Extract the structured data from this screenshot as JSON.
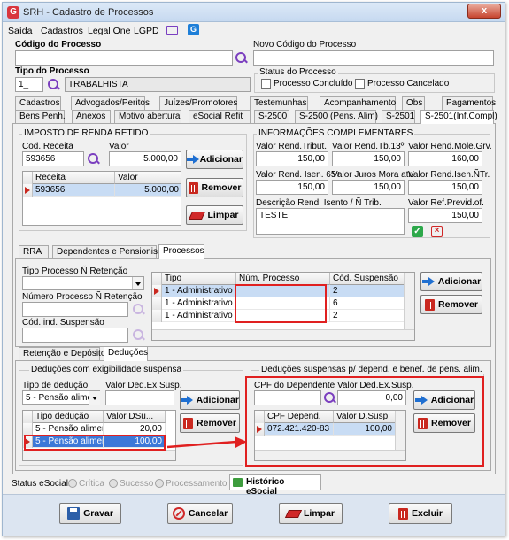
{
  "window": {
    "title": "SRH - Cadastro de Processos",
    "close_label": "x",
    "logo": "G"
  },
  "menu": {
    "items": [
      "Saída",
      "Cadastros",
      "Legal One",
      "LGPD"
    ],
    "g_icon": "G"
  },
  "header": {
    "codigo_label": "Código do Processo",
    "codigo_value": "",
    "novo_codigo_label": "Novo Código do Processo",
    "novo_codigo_value": "",
    "tipo_label": "Tipo do Processo",
    "tipo_code": "1_",
    "tipo_name": "TRABALHISTA",
    "status_label": "Status do Processo",
    "status_concluido": "Processo Concluído",
    "status_cancelado": "Processo Cancelado"
  },
  "tabs_row1": [
    "Cadastros",
    "Advogados/Peritos",
    "Juízes/Promotores",
    "Testemunhas",
    "Acompanhamento",
    "Obs",
    "Pagamentos"
  ],
  "tabs_row2": [
    "Bens Penh.",
    "Anexos",
    "Motivo abertura",
    "eSocial Refit",
    "S-2500",
    "S-2500 (Pens. Alim)",
    "S-2501",
    "S-2501(Inf.Compl)"
  ],
  "irrf": {
    "title": "IMPOSTO DE RENDA RETIDO",
    "cod_receita_label": "Cod. Receita",
    "cod_receita_value": "593656",
    "valor_label": "Valor",
    "valor_value": "5.000,00",
    "adicionar": "Adicionar",
    "remover": "Remover",
    "limpar": "Limpar",
    "grid_headers": [
      "Receita",
      "Valor"
    ],
    "grid_rows": [
      [
        "593656",
        "5.000,00"
      ]
    ]
  },
  "info": {
    "title": "INFORMAÇÕES COMPLEMENTARES",
    "f1_label": "Valor Rend.Tribut.",
    "f1_value": "150,00",
    "f2_label": "Valor Rend.Tb.13º",
    "f2_value": "150,00",
    "f3_label": "Valor Rend.Mole.Grv.",
    "f3_value": "160,00",
    "f4_label": "Valor Rend. Isen. 65+",
    "f4_value": "150,00",
    "f5_label": "Valor Juros Mora atr.",
    "f5_value": "150,00",
    "f6_label": "Valor Rend.Isen.ÑTr.",
    "f6_value": "150,00",
    "desc_label": "Descrição Rend. Isento / Ñ Trib.",
    "desc_value": "TESTE",
    "prev_label": "Valor Ref.Previd.of.",
    "prev_value": "150,00"
  },
  "subtabs": [
    "RRA",
    "Dependentes e Pensionistas",
    "Processos"
  ],
  "processos": {
    "tipo_label": "Tipo Processo Ñ Retenção",
    "numero_label": "Número Processo Ñ Retenção",
    "cod_ind_label": "Cód. ind. Suspensão",
    "grid_headers": [
      "Tipo",
      "Núm. Processo",
      "Cód. Suspensão"
    ],
    "grid_rows": [
      [
        "1 - Administrativo",
        "",
        "2"
      ],
      [
        "1 - Administrativo",
        "",
        "6"
      ],
      [
        "1 - Administrativo",
        "",
        "2"
      ]
    ],
    "adicionar": "Adicionar",
    "remover": "Remover"
  },
  "subtabs2": [
    "Retenção e Depósitos",
    "Deduções"
  ],
  "deducoes": {
    "title": "Deduções com exigibilidade suspensa",
    "tipo_label": "Tipo de dedução",
    "tipo_value": "5 - Pensão alimer",
    "valor_label": "Valor Ded.Ex.Susp.",
    "valor_value": "",
    "adicionar": "Adicionar",
    "remover": "Remover",
    "grid_headers": [
      "Tipo dedução",
      "Valor DSu..."
    ],
    "grid_rows": [
      [
        "5 - Pensão alimen...",
        "20,00"
      ],
      [
        "5 - Pensão alimen...",
        "100,00"
      ]
    ]
  },
  "suspensas": {
    "title": "Deduções suspensas p/ depend. e benef. de pens. alim.",
    "cpf_label": "CPF do Dependente",
    "cpf_value": "",
    "valor_label": "Valor Ded.Ex.Susp.",
    "valor_value": "0,00",
    "adicionar": "Adicionar",
    "remover": "Remover",
    "grid_headers": [
      "CPF Depend.",
      "Valor D.Susp."
    ],
    "grid_rows": [
      [
        "072.421.420-83",
        "100,00"
      ]
    ]
  },
  "esocial": {
    "label": "Status eSocial:",
    "critica": "Crítica",
    "sucesso": "Sucesso",
    "processamento": "Processamento",
    "historico": "Histórico eSocial"
  },
  "footer": {
    "gravar": "Gravar",
    "cancelar": "Cancelar",
    "limpar": "Limpar",
    "excluir": "Excluir"
  },
  "colors": {
    "accent_red": "#e02020",
    "selection": "#3c78d8",
    "search_icon": "#7b3fbf"
  }
}
